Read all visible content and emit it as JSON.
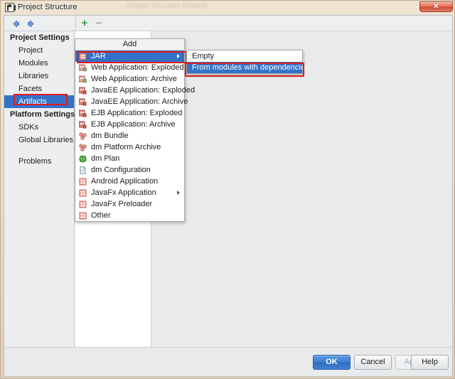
{
  "window": {
    "title": "Project Structure",
    "background_ghost_text": "Project Structure  Artifacts",
    "close_label": "✕"
  },
  "navbar": {
    "back_icon": "arrow-left-icon",
    "forward_icon": "arrow-right-icon"
  },
  "toolbar": {
    "add_label": "+",
    "remove_label": "−"
  },
  "sidebar": {
    "groups": [
      {
        "label": "Project Settings",
        "items": [
          {
            "label": "Project",
            "selected": false
          },
          {
            "label": "Modules",
            "selected": false
          },
          {
            "label": "Libraries",
            "selected": false
          },
          {
            "label": "Facets",
            "selected": false
          },
          {
            "label": "Artifacts",
            "selected": true
          }
        ]
      },
      {
        "label": "Platform Settings",
        "items": [
          {
            "label": "SDKs",
            "selected": false
          },
          {
            "label": "Global Libraries",
            "selected": false
          }
        ]
      }
    ],
    "problems_label": "Problems"
  },
  "menu": {
    "header": "Add",
    "items": [
      {
        "label": "JAR",
        "icon": "jar-icon",
        "selected": true,
        "submenu": true
      },
      {
        "label": "Web Application: Exploded",
        "icon": "web-app-icon",
        "selected": false,
        "submenu": false
      },
      {
        "label": "Web Application: Archive",
        "icon": "web-app-icon",
        "selected": false,
        "submenu": false
      },
      {
        "label": "JavaEE Application: Exploded",
        "icon": "javaee-app-icon",
        "selected": false,
        "submenu": false
      },
      {
        "label": "JavaEE Application: Archive",
        "icon": "javaee-app-icon",
        "selected": false,
        "submenu": false
      },
      {
        "label": "EJB Application: Exploded",
        "icon": "ejb-app-icon",
        "selected": false,
        "submenu": false
      },
      {
        "label": "EJB Application: Archive",
        "icon": "ejb-app-icon",
        "selected": false,
        "submenu": false
      },
      {
        "label": "dm Bundle",
        "icon": "dm-bundle-icon",
        "selected": false,
        "submenu": false
      },
      {
        "label": "dm Platform Archive",
        "icon": "dm-platform-icon",
        "selected": false,
        "submenu": false
      },
      {
        "label": "dm Plan",
        "icon": "dm-plan-globe-icon",
        "selected": false,
        "submenu": false
      },
      {
        "label": "dm Configuration",
        "icon": "document-icon",
        "selected": false,
        "submenu": false
      },
      {
        "label": "Android Application",
        "icon": "android-app-icon",
        "selected": false,
        "submenu": false
      },
      {
        "label": "JavaFx Application",
        "icon": "javafx-app-icon",
        "selected": false,
        "submenu": true
      },
      {
        "label": "JavaFx Preloader",
        "icon": "javafx-preloader-icon",
        "selected": false,
        "submenu": false
      },
      {
        "label": "Other",
        "icon": "other-icon",
        "selected": false,
        "submenu": false
      }
    ]
  },
  "submenu": {
    "items": [
      {
        "label": "Empty",
        "selected": false
      },
      {
        "label": "From modules with dependencies...",
        "selected": true
      }
    ]
  },
  "buttons": {
    "ok": "OK",
    "cancel": "Cancel",
    "apply": "Apply",
    "help": "Help"
  },
  "colors": {
    "selection_blue": "#3372c7",
    "annotation_red": "#e01b1b",
    "add_green": "#2e9e3f",
    "frame_tan": "#e8dac6"
  }
}
